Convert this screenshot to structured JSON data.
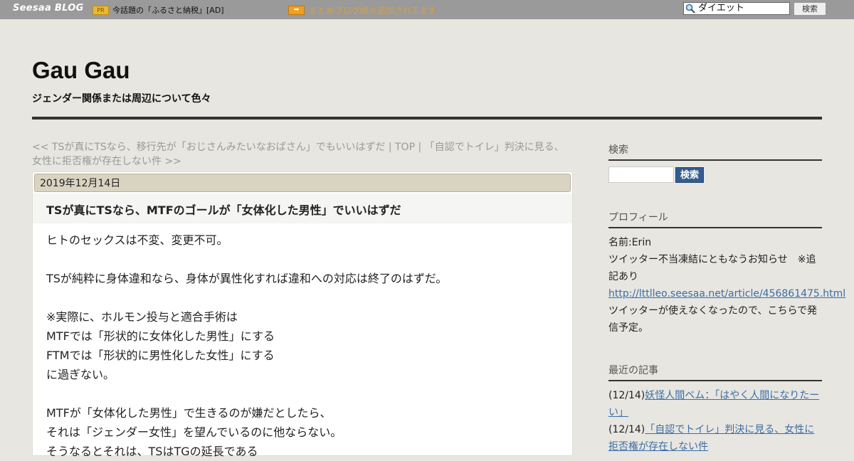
{
  "topbar": {
    "logo": "Seesaa BLOG",
    "pr_badge": "PR",
    "pr_text": "今話題の「ふるさと納税」[AD]",
    "arrow_badge": "➡",
    "matome_link": "まとめブログ続々追加されてます",
    "search_value": "ダイエット",
    "search_button": "検索"
  },
  "header": {
    "title": "Gau Gau",
    "description": "ジェンダー関係または周辺について色々"
  },
  "breadcrumb": {
    "prev": "<< TSが真にTSなら、移行先が「おじさんみたいなおばさん」でもいいはずだ",
    "sep1": " | ",
    "top": "TOP",
    "sep2": " | ",
    "next": "「自認でトイレ」判決に見る、女性に拒否権が存在しない件 >>"
  },
  "post": {
    "date": "2019年12月14日",
    "title": "TSが真にTSなら、MTFのゴールが「女体化した男性」でいいはずだ",
    "body": [
      "ヒトのセックスは不変、変更不可。",
      "",
      "TSが純粋に身体違和なら、身体が異性化すれば違和への対応は終了のはずだ。",
      "",
      "※実際に、ホルモン投与と適合手術は",
      "MTFでは「形状的に女体化した男性」にする",
      "FTMでは「形状的に男性化した女性」にする",
      "に過ぎない。",
      "",
      "MTFが「女体化した男性」で生きるのが嫌だとしたら、",
      "それは「ジェンダー女性」を望んでいるのに他ならない。",
      "そうなるとそれは、TSはTGの延長である"
    ]
  },
  "sidebar": {
    "search_heading": "検索",
    "search_button": "検索",
    "profile_heading": "プロフィール",
    "profile_name": "名前:Erin",
    "profile_notice": "ツイッター不当凍結にともなうお知らせ　※追記あり",
    "profile_link": "http://lttlleo.seesaa.net/article/456861475.html",
    "profile_note": "ツイッターが使えなくなったので、こちらで発信予定。",
    "recent_heading": "最近の記事",
    "recent": [
      {
        "date": "(12/14)",
        "title": "妖怪人間ベム：「はやく人間になりたーい」"
      },
      {
        "date": "(12/14)",
        "title": "「自認でトイレ」判決に見る、女性に拒否権が存在しない件"
      }
    ]
  }
}
